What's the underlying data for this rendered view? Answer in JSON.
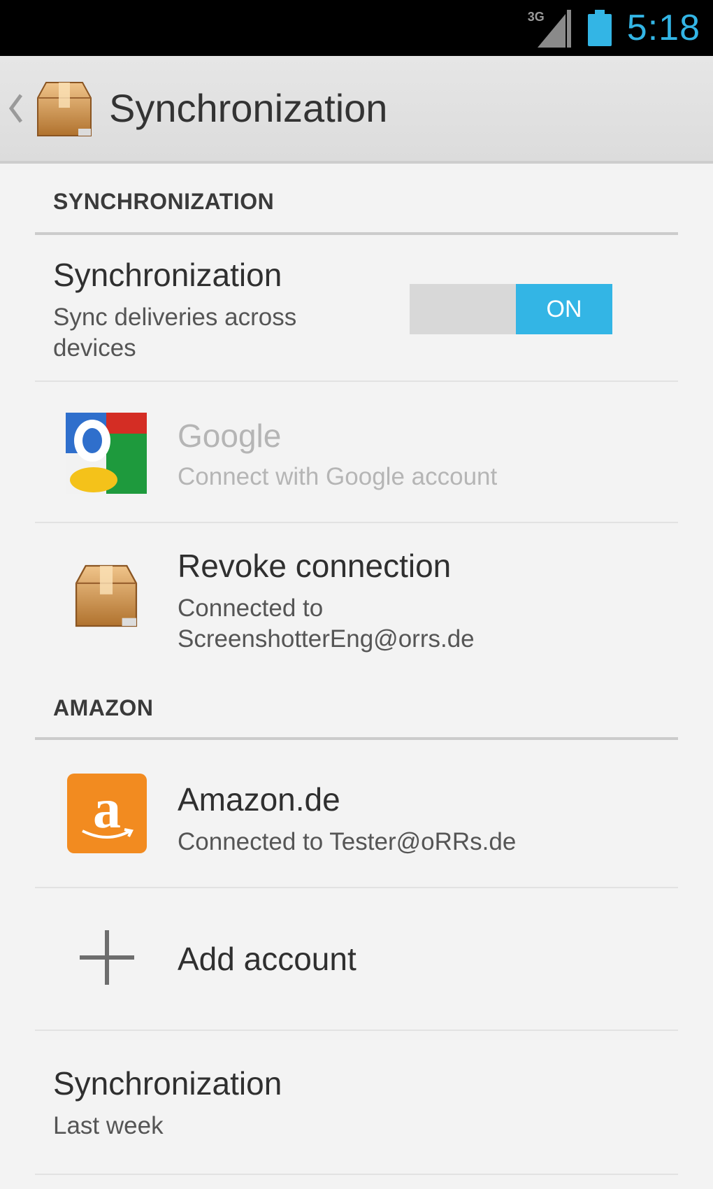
{
  "status_bar": {
    "network": "3G",
    "time": "5:18",
    "accent": "#33b5e5"
  },
  "action_bar": {
    "title": "Synchronization"
  },
  "sections": {
    "sync_header": "SYNCHRONIZATION",
    "amazon_header": "AMAZON"
  },
  "sync_toggle_row": {
    "title": "Synchronization",
    "summary_line1": "Sync deliveries across",
    "summary_line2": "devices",
    "toggle_label": "ON"
  },
  "google_row": {
    "title": "Google",
    "summary": "Connect with Google account"
  },
  "revoke_row": {
    "title": "Revoke connection",
    "summary_line1": "Connected to",
    "summary_line2": "ScreenshotterEng@orrs.de"
  },
  "amazon_row": {
    "icon_letter": "a",
    "title": "Amazon.de",
    "summary": "Connected to Tester@oRRs.de"
  },
  "add_account_row": {
    "title": "Add account"
  },
  "sync_interval_row": {
    "title": "Synchronization",
    "summary": "Last week"
  }
}
